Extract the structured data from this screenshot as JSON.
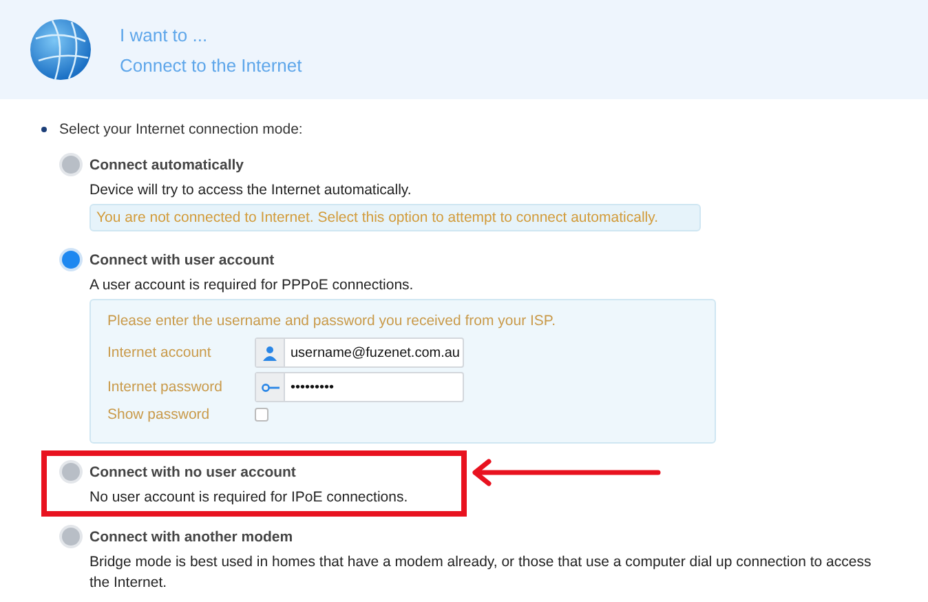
{
  "header": {
    "title": "I want to ...",
    "subtitle": "Connect to the Internet"
  },
  "prompt": "Select your Internet connection mode:",
  "options": [
    {
      "title": "Connect automatically",
      "description": "Device will try to access the Internet automatically.",
      "selected": false,
      "highlighted": false,
      "notice": "You are not connected to Internet. Select this option to attempt to connect automatically."
    },
    {
      "title": "Connect with user account",
      "description": "A user account is required for PPPoE connections.",
      "selected": true,
      "highlighted": false,
      "form": {
        "hint": "Please enter the username and password you received from your ISP.",
        "fields": [
          {
            "label": "Internet account",
            "value": "username@fuzenet.com.au",
            "kind": "user"
          },
          {
            "label": "Internet password",
            "value": "•••••••••",
            "kind": "key"
          }
        ],
        "show_password": {
          "label": "Show password",
          "checked": false
        }
      }
    },
    {
      "title": "Connect with no user account",
      "description": "No user account is required for IPoE connections.",
      "selected": false,
      "highlighted": true
    },
    {
      "title": "Connect with another modem",
      "description": "Bridge mode is best used in homes that have a modem already, or those that use a computer dial up connection to access the Internet.",
      "selected": false,
      "highlighted": false
    }
  ]
}
